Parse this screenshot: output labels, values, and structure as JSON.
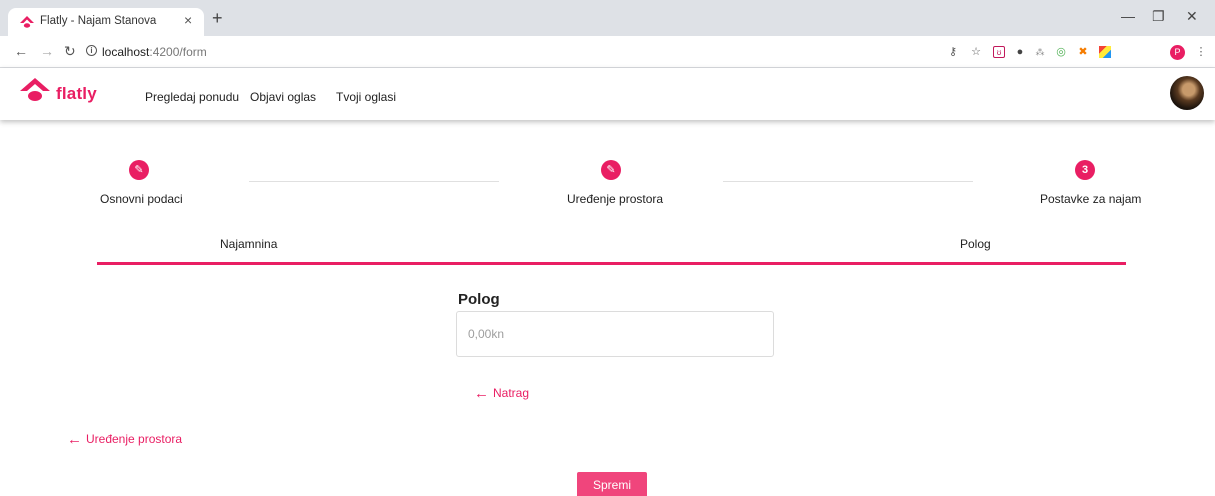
{
  "browser": {
    "tab_title": "Flatly - Najam Stanova",
    "tab_close": "×",
    "new_tab": "+",
    "url_host": "localhost",
    "url_path": ":4200/form",
    "window_controls": [
      "—",
      "❐",
      "✕"
    ],
    "profile_initial": "P"
  },
  "header": {
    "brand": "flatly",
    "brand_color": "#e91e63",
    "nav": [
      "Pregledaj ponudu",
      "Objavi oglas",
      "Tvoji oglasi"
    ]
  },
  "stepper": {
    "steps": [
      {
        "label": "Osnovni podaci",
        "icon": "edit-icon",
        "symbol": "✎"
      },
      {
        "label": "Uređenje prostora",
        "icon": "edit-icon",
        "symbol": "✎"
      },
      {
        "label": "Postavke za najam",
        "icon": "step-number",
        "symbol": "3"
      }
    ]
  },
  "subtabs": [
    "Najamnina",
    "Polog"
  ],
  "form": {
    "field_label": "Polog",
    "field_placeholder": "0,00kn",
    "back_label": "Natrag",
    "prev_step_label": "Uređenje prostora",
    "save_label": "Spremi"
  }
}
